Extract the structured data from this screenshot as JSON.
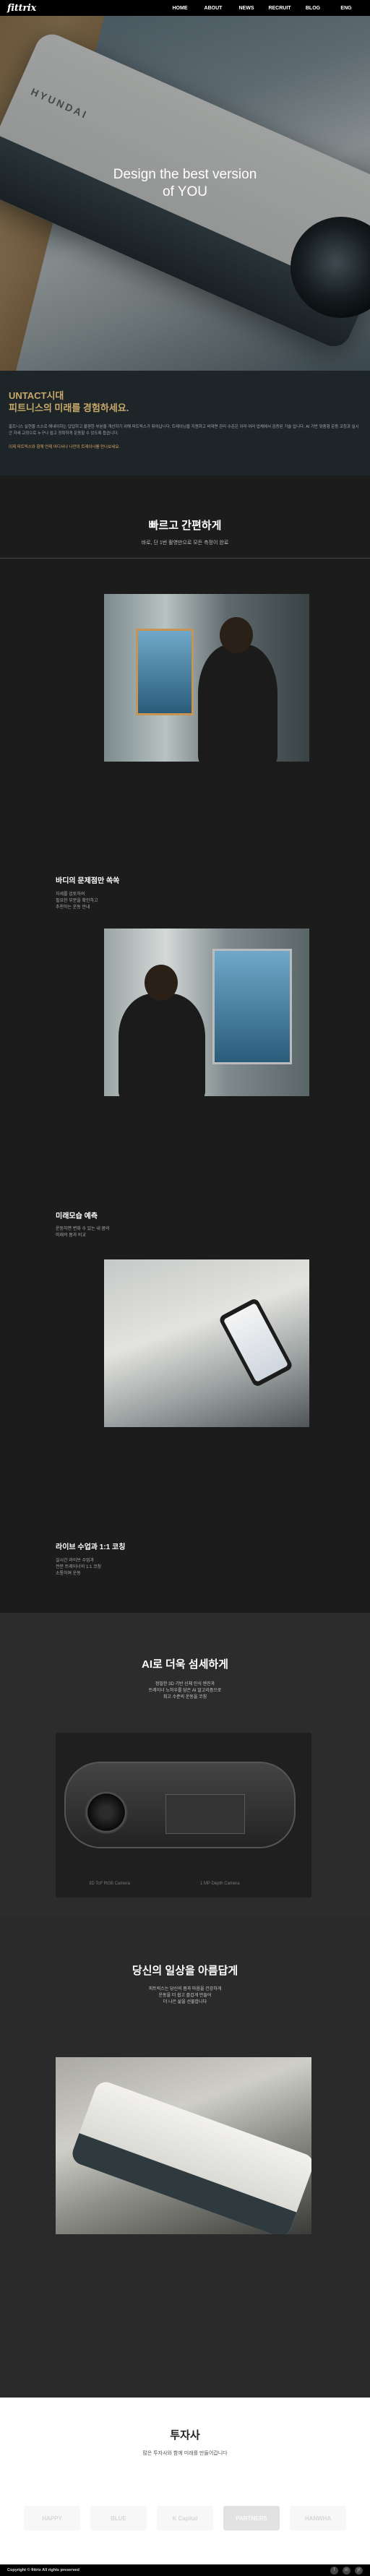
{
  "nav": {
    "logo": "fittrix",
    "items": [
      {
        "label": "HOME"
      },
      {
        "label": "ABOUT"
      },
      {
        "label": "NEWS"
      },
      {
        "label": "RECRUIT"
      },
      {
        "label": "BLOG"
      },
      {
        "label": "ENG"
      }
    ]
  },
  "hero": {
    "brand_text": "HYUNDAI",
    "title_line1": "Design the best version",
    "title_line2": "of YOU"
  },
  "intro": {
    "headline_1": "UNTACT시대",
    "headline_2": "피트니스의 미래를 경험하세요.",
    "paragraph": "홈트니스 실현을 스스로 해내야하는 답답하고 불편한 부분을 개선하기 위해 피트릭스가 뛰어납니다. 트레이닝을 지원하고 비대면 관리 수준은 이미 여러 업체에서 검증된 기술 입니다. AI 기반 맞춤형 운동 코칭과 실시간 자세 교정으로 누구나 쉽고 정확하게 운동할 수 있도록 돕습니다.",
    "paragraph_accent": "이제 피트릭스와 함께 언제 어디서나 나만의 트레이너를 만나보세요."
  },
  "features": {
    "title": "빠르고 간편하게",
    "subtitle": "바로, 단 1번 촬영만으로 모든 측정이 완료",
    "blocks": [
      {
        "heading": "바디의 문제점만 쏙쏙",
        "lines": [
          "자세를 검토하여",
          "필요한 부분을 확인하고",
          "추천하는 운동 안내"
        ]
      },
      {
        "heading": "미래모습 예측",
        "lines": [
          "운동하면 변화 수 있는 내 몸의",
          "미래의 몸과 비교"
        ]
      },
      {
        "heading": "라이브 수업과 1:1 코칭",
        "lines": [
          "실시간 라이브 수업과",
          "전문 트레이너의 1:1 코칭",
          "소통하며 운동"
        ]
      }
    ]
  },
  "ai": {
    "title": "AI로 더욱 섬세하게",
    "lines": [
      "정밀한 3D 기반 신체 인식 엔진과",
      "트레이너 노하우를 담은 AI 알고리즘으로",
      "최고 수준의 운동을 코칭"
    ],
    "camera_labels": [
      "3D ToF RGB Camera",
      "1 MP Depth Camera"
    ]
  },
  "daily": {
    "title": "당신의 일상을 아름답게",
    "lines": [
      "피트릭스는 당신의 몸과 마음을 건강하게",
      "운동을 더 쉽고 즐겁게 만들어",
      "더 나은 삶을 선물합니다"
    ]
  },
  "investors": {
    "title": "투자사",
    "subtitle": "많은 투자사와 함께 미래를 만들어갑니다",
    "logos": [
      "HAPPY",
      "BLUE",
      "K Capital",
      "PARTNERS",
      "HANWHA"
    ]
  },
  "footer": {
    "copyright": "Copyright © fittrix All rights preserved",
    "social": [
      "f",
      "in",
      "yt"
    ]
  }
}
